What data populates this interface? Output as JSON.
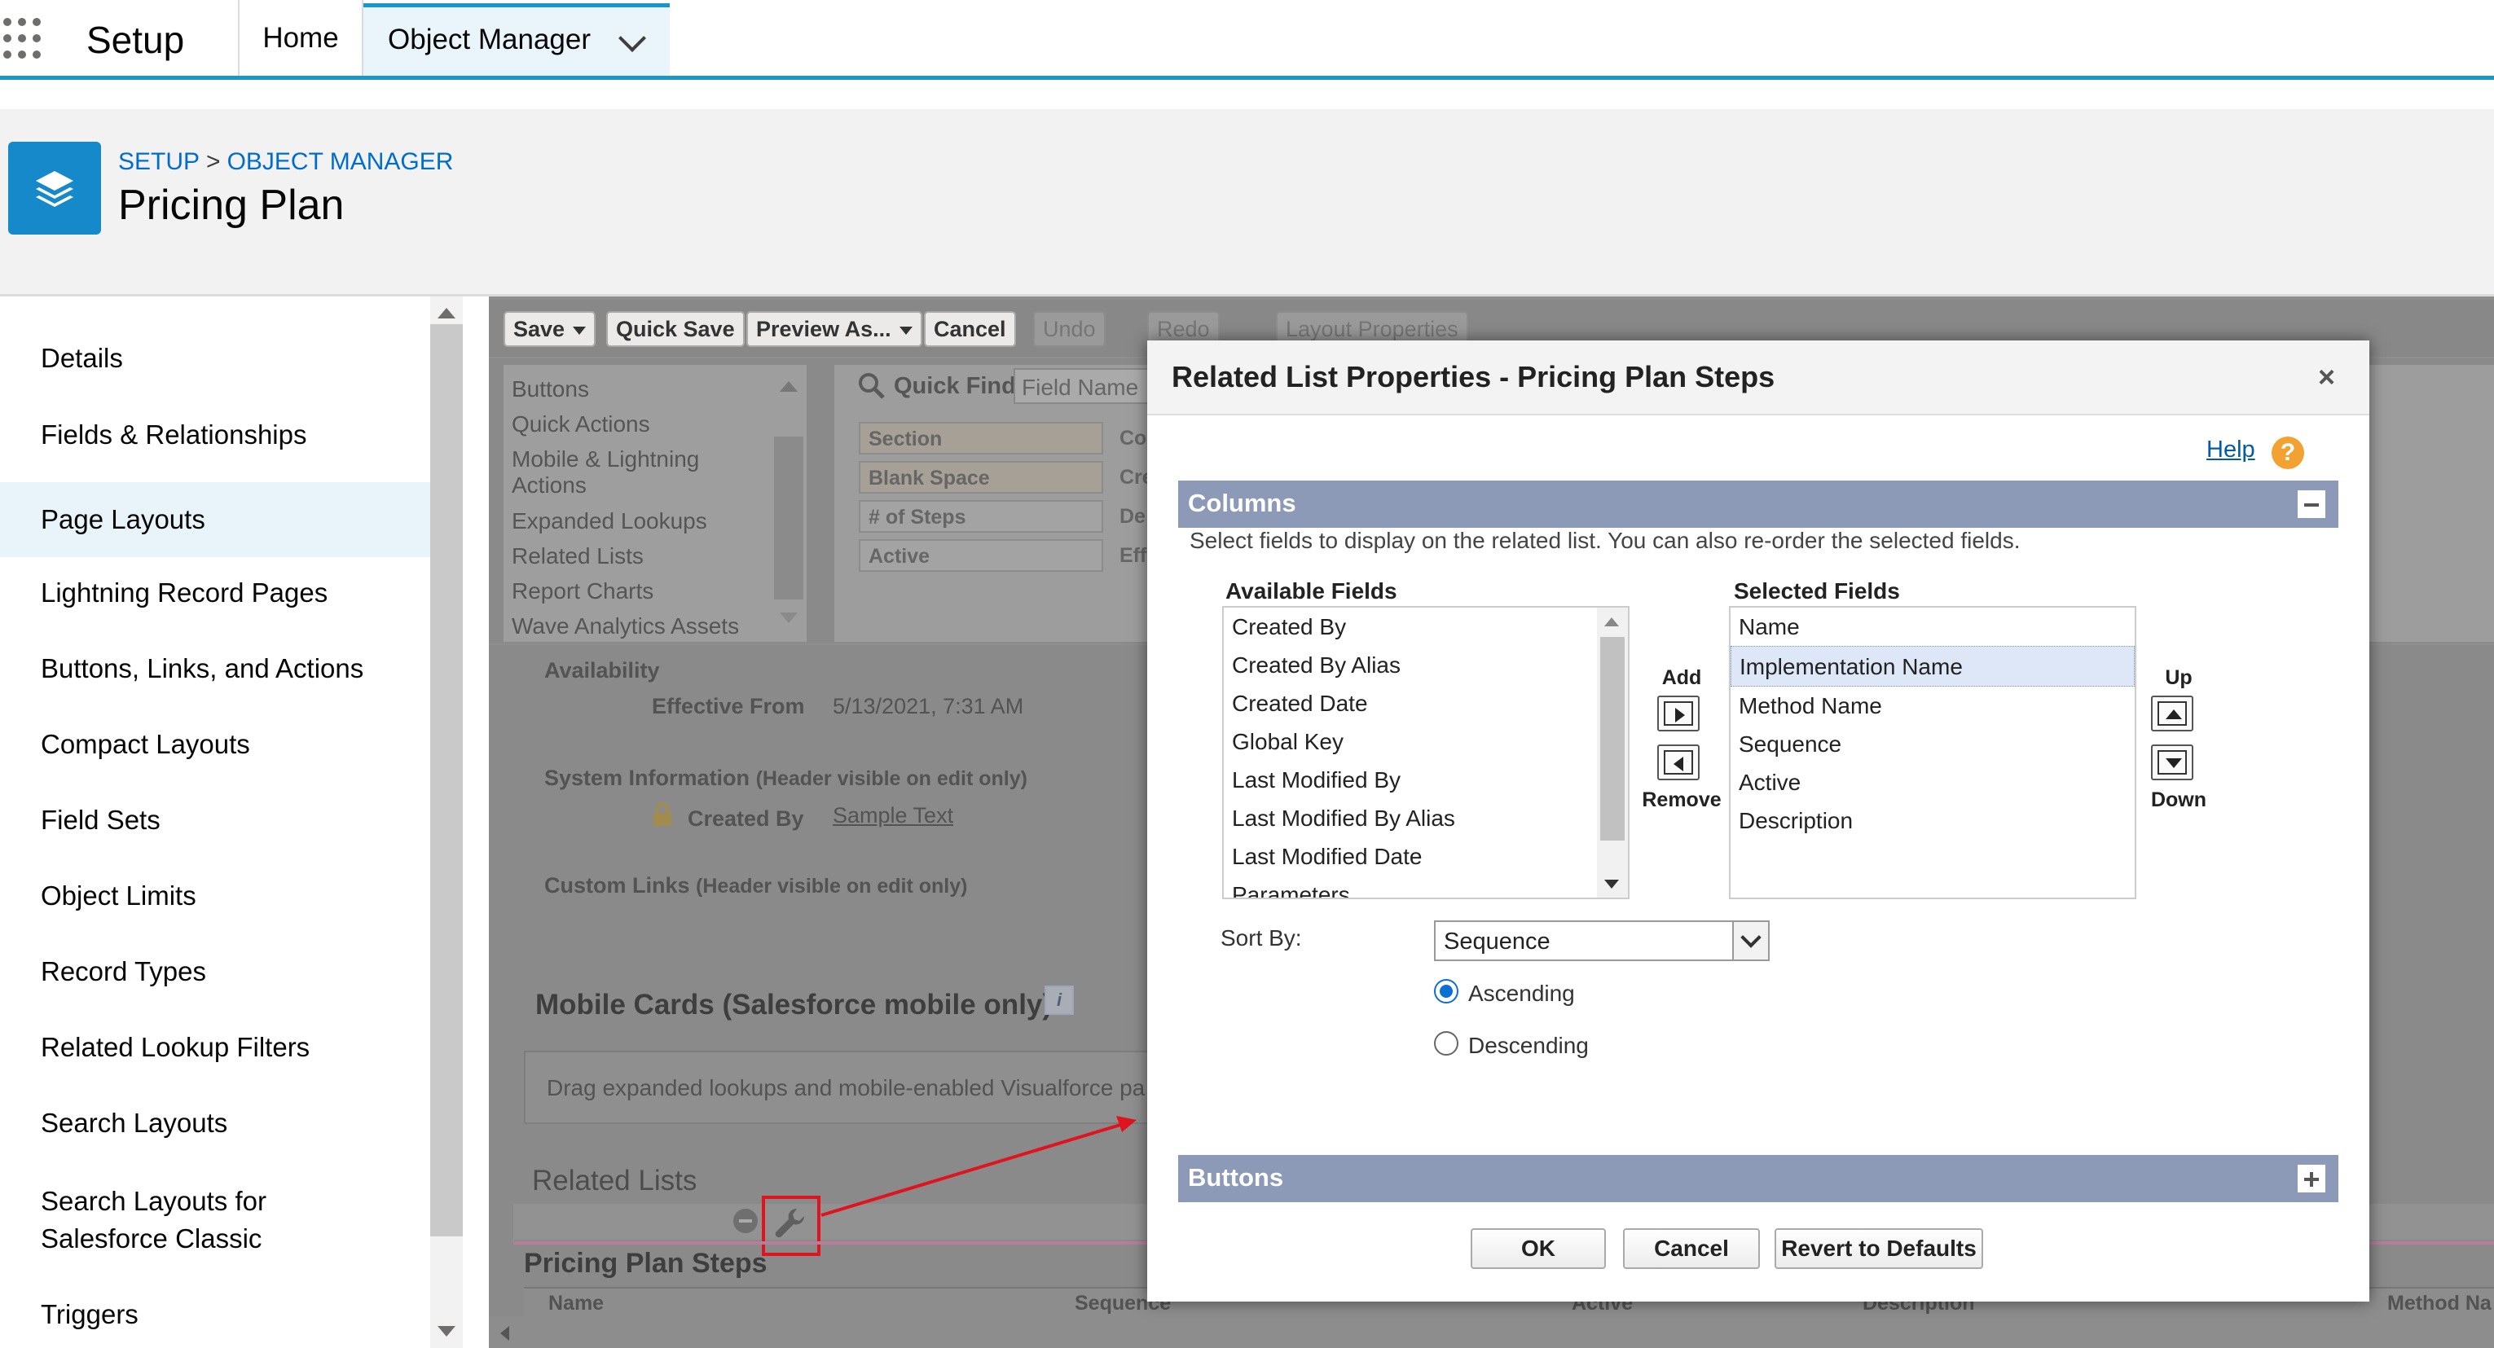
{
  "topnav": {
    "app_name": "Setup",
    "tabs": [
      {
        "label": "Home"
      },
      {
        "label": "Object Manager"
      }
    ]
  },
  "header": {
    "breadcrumb": [
      "SETUP",
      "OBJECT MANAGER"
    ],
    "breadcrumb_separator": ">",
    "title": "Pricing Plan"
  },
  "sidebar": {
    "items": [
      {
        "label": "Details"
      },
      {
        "label": "Fields & Relationships"
      },
      {
        "label": "Page Layouts",
        "active": true
      },
      {
        "label": "Lightning Record Pages"
      },
      {
        "label": "Buttons, Links, and Actions"
      },
      {
        "label": "Compact Layouts"
      },
      {
        "label": "Field Sets"
      },
      {
        "label": "Object Limits"
      },
      {
        "label": "Record Types"
      },
      {
        "label": "Related Lookup Filters"
      },
      {
        "label": "Search Layouts"
      },
      {
        "label": "Search Layouts for",
        "label2": "Salesforce Classic"
      },
      {
        "label": "Triggers"
      }
    ]
  },
  "editor": {
    "toolbar": {
      "save": "Save",
      "quick_save": "Quick Save",
      "preview_as": "Preview As...",
      "cancel": "Cancel",
      "undo": "Undo",
      "redo": "Redo",
      "layout_properties": "Layout Properties"
    },
    "palette_categories": [
      "Buttons",
      "Quick Actions",
      "Mobile & Lightning",
      "Actions",
      "Expanded Lookups",
      "Related Lists",
      "Report Charts",
      "Wave Analytics Assets"
    ],
    "quick_find_label": "Quick Find",
    "quick_find_placeholder": "Field Name",
    "palette_items": [
      "Section",
      "Blank Space",
      "# of Steps",
      "Active"
    ],
    "palette_col2": [
      "Co",
      "Cre",
      "De",
      "Eff"
    ],
    "availability_label": "Availability",
    "effective_from_label": "Effective From",
    "effective_from_value": "5/13/2021, 7:31 AM",
    "system_info_label": "System Information",
    "system_info_note": "(Header visible on edit only)",
    "created_by_label": "Created By",
    "created_by_value": "Sample Text",
    "custom_links_label": "Custom Links",
    "custom_links_note": "(Header visible on edit only)",
    "mobile_cards_title": "Mobile Cards (Salesforce mobile only)",
    "mobile_cards_desc": "Drag expanded lookups and mobile-enabled Visualforce pa",
    "related_lists_title": "Related Lists",
    "related_list_name": "Pricing Plan Steps",
    "related_list_columns": [
      "Name",
      "Sequence",
      "Active",
      "Description",
      "Method Na"
    ]
  },
  "modal": {
    "title": "Related List Properties - Pricing Plan Steps",
    "close": "×",
    "help": "Help",
    "help_icon": "?",
    "columns_section": "Columns",
    "columns_desc": "Select fields to display on the related list. You can also re-order the selected fields.",
    "available_caption": "Available Fields",
    "available_fields": [
      "Created By",
      "Created By Alias",
      "Created Date",
      "Global Key",
      "Last Modified By",
      "Last Modified By Alias",
      "Last Modified Date",
      "Parameters"
    ],
    "selected_caption": "Selected Fields",
    "selected_fields": [
      "Name",
      "Implementation Name",
      "Method Name",
      "Sequence",
      "Active",
      "Description"
    ],
    "selected_index": 1,
    "add_label": "Add",
    "remove_label": "Remove",
    "up_label": "Up",
    "down_label": "Down",
    "sort_by_label": "Sort By:",
    "sort_by_value": "Sequence",
    "ascending_label": "Ascending",
    "descending_label": "Descending",
    "sort_order": "ascending",
    "buttons_section": "Buttons",
    "ok": "OK",
    "cancel": "Cancel",
    "revert": "Revert to Defaults"
  },
  "colors": {
    "brand_blue": "#1b96ca",
    "section_bar": "#8c9ab8",
    "highlight_red": "#e0141e"
  }
}
